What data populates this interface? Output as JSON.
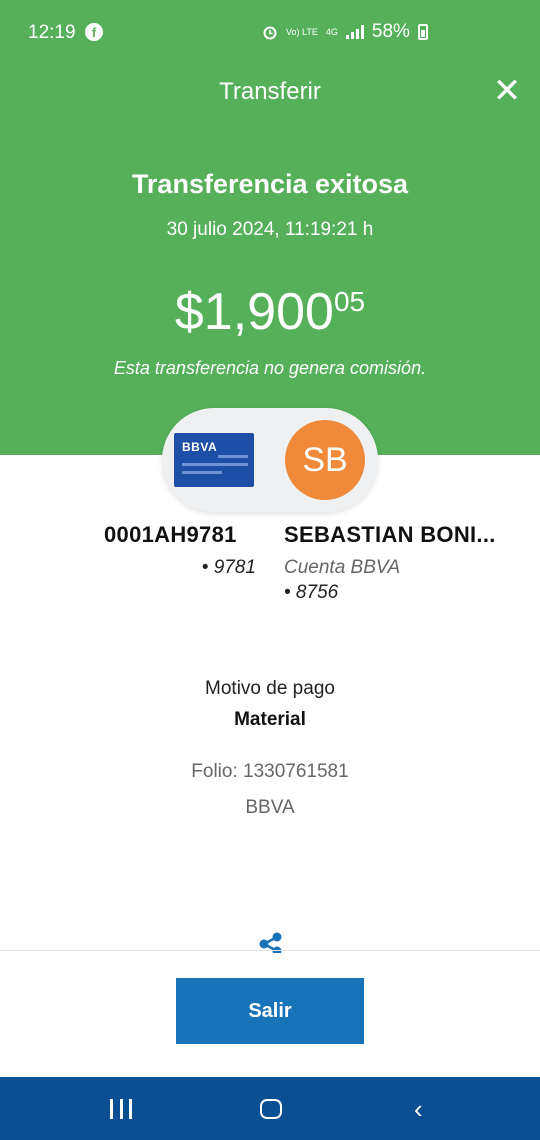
{
  "status_bar": {
    "time": "12:19",
    "notification_icon": "facebook-icon",
    "volte_label": "Vo) LTE",
    "network_label": "4G",
    "battery": "58%"
  },
  "topbar": {
    "title": "Transferir",
    "close_icon": "close-icon"
  },
  "result": {
    "title": "Transferencia exitosa",
    "datetime": "30 julio 2024, 11:19:21 h",
    "amount_main": "$1,900",
    "amount_cents": "05",
    "commission_note": "Esta transferencia no genera comisión."
  },
  "source_account": {
    "card_brand": "BBVA",
    "name": "0001AH9781",
    "number": "• 9781"
  },
  "destination_account": {
    "initials": "SB",
    "name": "SEBASTIAN BONI...",
    "type": "Cuenta BBVA",
    "number": "• 8756"
  },
  "details": {
    "motivo_label": "Motivo de pago",
    "motivo_value": "Material",
    "folio": "Folio: 1330761581",
    "bank": "BBVA"
  },
  "actions": {
    "share_icon": "share-icon",
    "exit_button": "Salir"
  },
  "colors": {
    "header_green": "#56b05a",
    "primary_blue": "#1973b8",
    "navbar_blue": "#0b4f93",
    "avatar_orange": "#f08a3a",
    "card_blue": "#1e4fa6"
  }
}
